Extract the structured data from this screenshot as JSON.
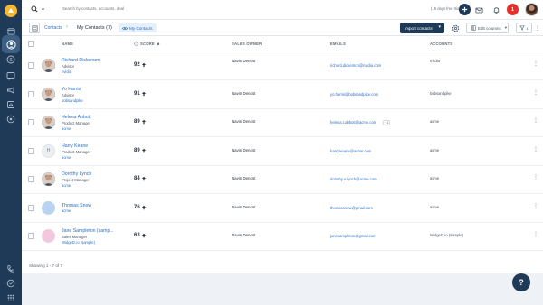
{
  "app": {
    "trial_text": "(19 days free trial)",
    "notification_count": "1",
    "help_label": "?"
  },
  "search": {
    "placeholder": "Search by contacts, accounts, deal"
  },
  "breadcrumb": {
    "root": "Contacts",
    "separator": "›",
    "title": "My Contacts (7)",
    "view_chip": "My Contacts"
  },
  "toolbar": {
    "import_label": "Import contacts",
    "edit_columns_label": "Edit columns",
    "filter_count": "1"
  },
  "table": {
    "headers": {
      "name": "NAME",
      "score": "SCORE",
      "owner": "SALES OWNER",
      "emails": "EMAILS",
      "accounts": "ACCOUNTS"
    },
    "rows": [
      {
        "name": "Richard Dickerson",
        "title": "Advisor",
        "company": "nvidia",
        "score": "92",
        "trend": "up",
        "owner": "Navin Denost",
        "email": "richard.dickerson@nvidia.com",
        "email_more": "",
        "account": "nvidia",
        "avatar_type": "photo",
        "avatar_color": "#4d3b32",
        "initial": ""
      },
      {
        "name": "Yo Harris",
        "title": "Advisor",
        "company": "bobsandpike",
        "score": "91",
        "trend": "up",
        "owner": "Navin Denost",
        "email": "yo.harris@bobsandpike.com",
        "email_more": "",
        "account": "bobsandpike",
        "avatar_type": "photo",
        "avatar_color": "#3b2f2a",
        "initial": ""
      },
      {
        "name": "Helena Abbott",
        "title": "Product Manager",
        "company": "acme",
        "score": "89",
        "trend": "up",
        "owner": "Navin Denost",
        "email": "helena.t.abbott@acme.com",
        "email_more": "+1",
        "account": "acme",
        "avatar_type": "photo",
        "avatar_color": "#6d6560",
        "initial": ""
      },
      {
        "name": "Harry Keane",
        "title": "Product Manager",
        "company": "acme",
        "score": "89",
        "trend": "up",
        "owner": "Navin Denost",
        "email": "harry.keane@acme.com",
        "email_more": "",
        "account": "acme",
        "avatar_type": "initial",
        "avatar_color": "#eceff2",
        "initial": "H"
      },
      {
        "name": "Dorothy Lynch",
        "title": "Project Manager",
        "company": "acme",
        "score": "84",
        "trend": "up",
        "owner": "Navin Denost",
        "email": "dorothy.a.lynch@acme.com",
        "email_more": "",
        "account": "acme",
        "avatar_type": "photo",
        "avatar_color": "#8a5a3c",
        "initial": ""
      },
      {
        "name": "Thomas Snow",
        "title": "",
        "company": "acme",
        "score": "76",
        "trend": "up",
        "owner": "Navin Denost",
        "email": "thomassnow@gmail.com",
        "email_more": "",
        "account": "acme",
        "avatar_type": "color",
        "avatar_color": "#b9d3f1",
        "initial": ""
      },
      {
        "name": "Jane Sampleton (samp...",
        "title": "Sales Manager",
        "company": "Widgetz.io (sample)",
        "score": "63",
        "trend": "up",
        "owner": "Navin Denost",
        "email": "janesampleton@gmail.com",
        "email_more": "",
        "account": "Widgetz.io (sample)",
        "avatar_type": "color",
        "avatar_color": "#f2c8de",
        "initial": ""
      }
    ]
  },
  "footer": {
    "showing_text": "Showing 1 - 7 of 7"
  },
  "colors": {
    "sidebar": "#1f3a57",
    "accent_link": "#2c6fc0",
    "notification": "#e5302b",
    "logo": "#f4b733"
  }
}
